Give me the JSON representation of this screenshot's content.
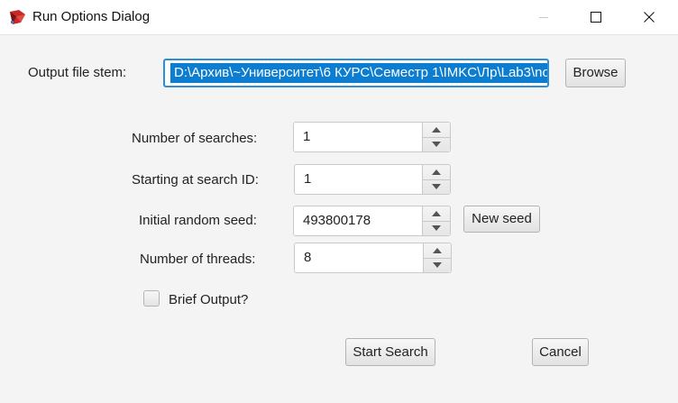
{
  "window": {
    "title": "Run Options Dialog",
    "app_icon": "app-logo-icon",
    "controls": [
      "minimize-icon",
      "maximize-icon",
      "close-icon"
    ]
  },
  "output": {
    "label": "Output file stem:",
    "value": "D:\\Архив\\~Университет\\6 КУРС\\Семестр 1\\IMKC\\Лр\\Lab3\\no",
    "browse_label": "Browse"
  },
  "fields": {
    "searches": {
      "label": "Number of searches:",
      "value": "1"
    },
    "start_id": {
      "label": "Starting at search ID:",
      "value": "1"
    },
    "seed": {
      "label": "Initial random seed:",
      "value": "493800178",
      "new_seed_label": "New seed"
    },
    "threads": {
      "label": "Number of threads:",
      "value": "8"
    }
  },
  "brief_output": {
    "label": "Brief Output?",
    "checked": false
  },
  "actions": {
    "start_label": "Start Search",
    "cancel_label": "Cancel"
  },
  "colors": {
    "accent": "#2a8fd6",
    "selection": "#0c7dd0",
    "background": "#f4f4f4"
  }
}
